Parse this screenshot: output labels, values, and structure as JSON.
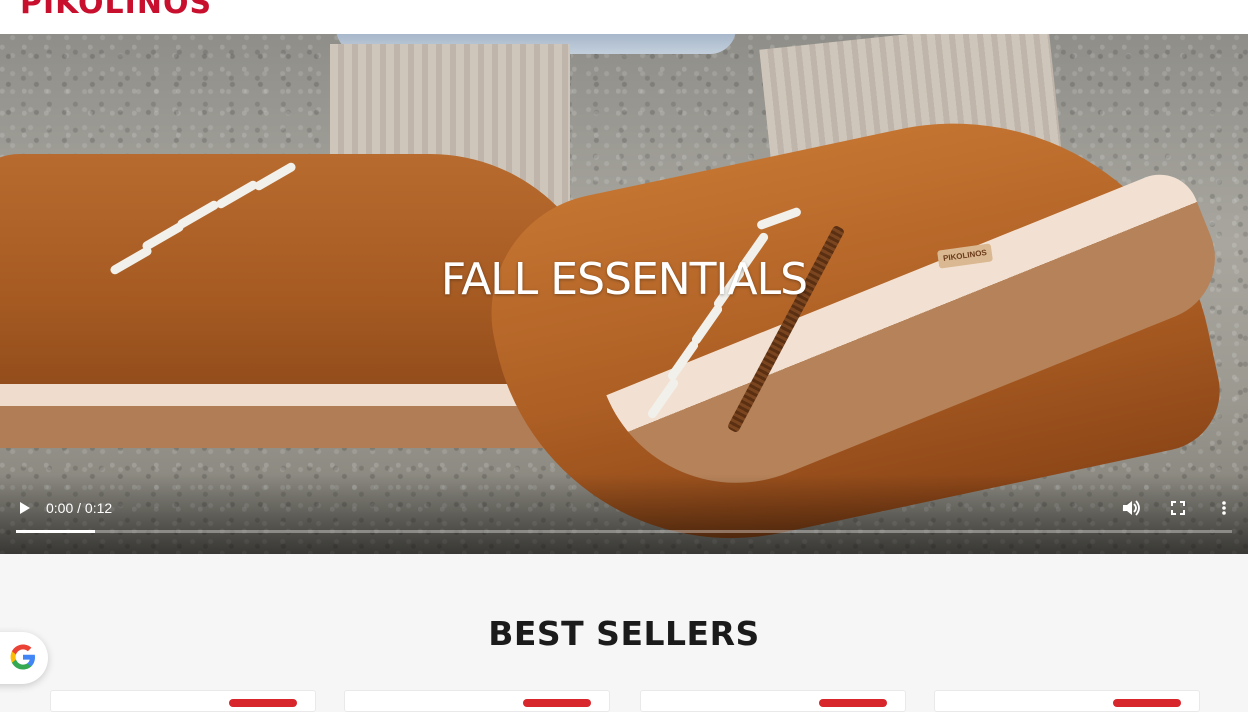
{
  "brand": {
    "logo_text": "PIKOLINOS",
    "accent_color": "#c8102e"
  },
  "nav": {
    "items": [
      "",
      "",
      "",
      "",
      "",
      ""
    ]
  },
  "header_icons": [
    "user-icon",
    "search-icon",
    "bag-icon"
  ],
  "hero": {
    "title": "FALL ESSENTIALS",
    "shoe_badge": "PIKOLINOS",
    "video": {
      "time_display": "0:00 / 0:12",
      "progress": 0.065,
      "controls": [
        "play-icon",
        "volume-icon",
        "fullscreen-icon",
        "more-icon"
      ]
    }
  },
  "best_sellers": {
    "title": "BEST SELLERS",
    "cards": [
      {},
      {},
      {},
      {}
    ]
  },
  "google_badge": {
    "icon": "google-icon"
  }
}
